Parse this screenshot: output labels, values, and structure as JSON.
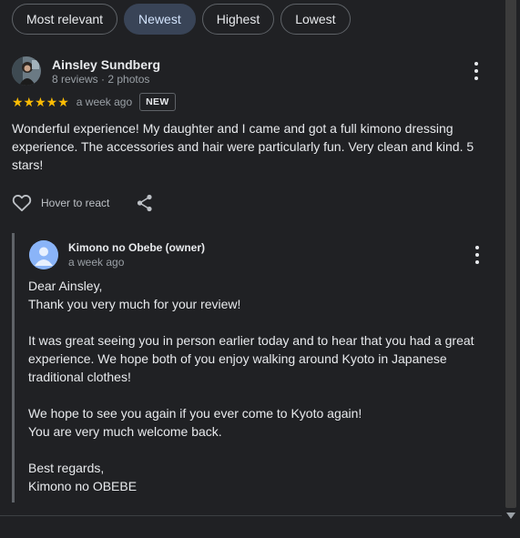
{
  "filters": {
    "chips": [
      {
        "label": "Most relevant"
      },
      {
        "label": "Newest"
      },
      {
        "label": "Highest"
      },
      {
        "label": "Lowest"
      }
    ],
    "selected": "Newest"
  },
  "review": {
    "name": "Ainsley Sundberg",
    "meta": "8 reviews · 2 photos",
    "stars": "★★★★★",
    "rating": 5,
    "time": "a week ago",
    "badge": "NEW",
    "text": "Wonderful experience! My daughter and I came and got a full kimono dressing experience. The accessories and hair were particularly fun. Very clean and kind. 5 stars!",
    "react_label": "Hover to react"
  },
  "owner_response": {
    "name": "Kimono no Obebe (owner)",
    "time": "a week ago",
    "lines": {
      "greeting": "Dear Ainsley,",
      "thanks": "Thank you very much for your review!",
      "para1": "It was great seeing you in person earlier today and to hear that you had a great experience. We hope both of you enjoy walking around Kyoto in Japanese traditional clothes!",
      "para2a": "We hope to see you again if you ever come to Kyoto again!",
      "para2b": "You are very much welcome back.",
      "closing": "Best regards,",
      "signature": "Kimono no OBEBE"
    }
  },
  "colors": {
    "background": "#202124",
    "star": "#fbbc04",
    "selected_chip": "#394457",
    "owner_avatar": "#8ab4f8"
  },
  "icons": [
    "more-vert-icon",
    "heart-icon",
    "share-icon",
    "person-icon",
    "scroll-down-arrow-icon"
  ]
}
